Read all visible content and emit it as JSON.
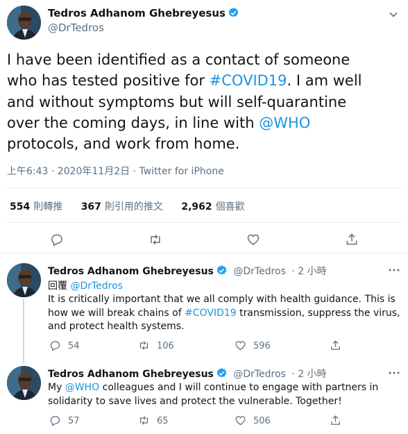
{
  "colors": {
    "link": "#1b95e0",
    "secondary": "#5b7083",
    "verified": "#1da1f2",
    "text": "#0f1419"
  },
  "main_tweet": {
    "author_name": "Tedros Adhanom Ghebreyesus",
    "author_handle": "@DrTedros",
    "text_parts": [
      {
        "text": "I have been identified as a contact of someone\nwho has tested positive for ",
        "link": false
      },
      {
        "text": "#COVID19",
        "link": true
      },
      {
        "text": ". I am well\nand without symptoms but will self-quarantine\nover the coming days, in line with ",
        "link": false
      },
      {
        "text": "@WHO",
        "link": true
      },
      {
        "text": "\nprotocols, and work from home.",
        "link": false
      }
    ],
    "timestamp": "上午6:43 · 2020年11月2日 · Twitter for iPhone",
    "stats": {
      "retweets_count": "554",
      "retweets_label": "則轉推",
      "quotes_count": "367",
      "quotes_label": "則引用的推文",
      "likes_count": "2,962",
      "likes_label": "個喜歡"
    },
    "actions": [
      "reply-icon",
      "retweet-icon",
      "like-icon",
      "share-icon"
    ]
  },
  "replies": [
    {
      "author_name": "Tedros Adhanom Ghebreyesus",
      "author_handle": "@DrTedros",
      "time": "· 2 小時",
      "replying_to_label": "回覆",
      "replying_to_handle": "@DrTedros",
      "text_parts": [
        {
          "text": "It is critically important that we all comply with health guidance. This is how we will break chains of ",
          "link": false
        },
        {
          "text": "#COVID19",
          "link": true
        },
        {
          "text": " transmission, suppress the virus, and protect health systems.",
          "link": false
        }
      ],
      "reply_count": "54",
      "retweet_count": "106",
      "like_count": "596"
    },
    {
      "author_name": "Tedros Adhanom Ghebreyesus",
      "author_handle": "@DrTedros",
      "time": "· 2 小時",
      "text_parts": [
        {
          "text": "My ",
          "link": false
        },
        {
          "text": "@WHO",
          "link": true
        },
        {
          "text": " colleagues and I will continue to engage with partners in solidarity to save lives and protect the vulnerable. Together!",
          "link": false
        }
      ],
      "reply_count": "57",
      "retweet_count": "65",
      "like_count": "506"
    }
  ]
}
